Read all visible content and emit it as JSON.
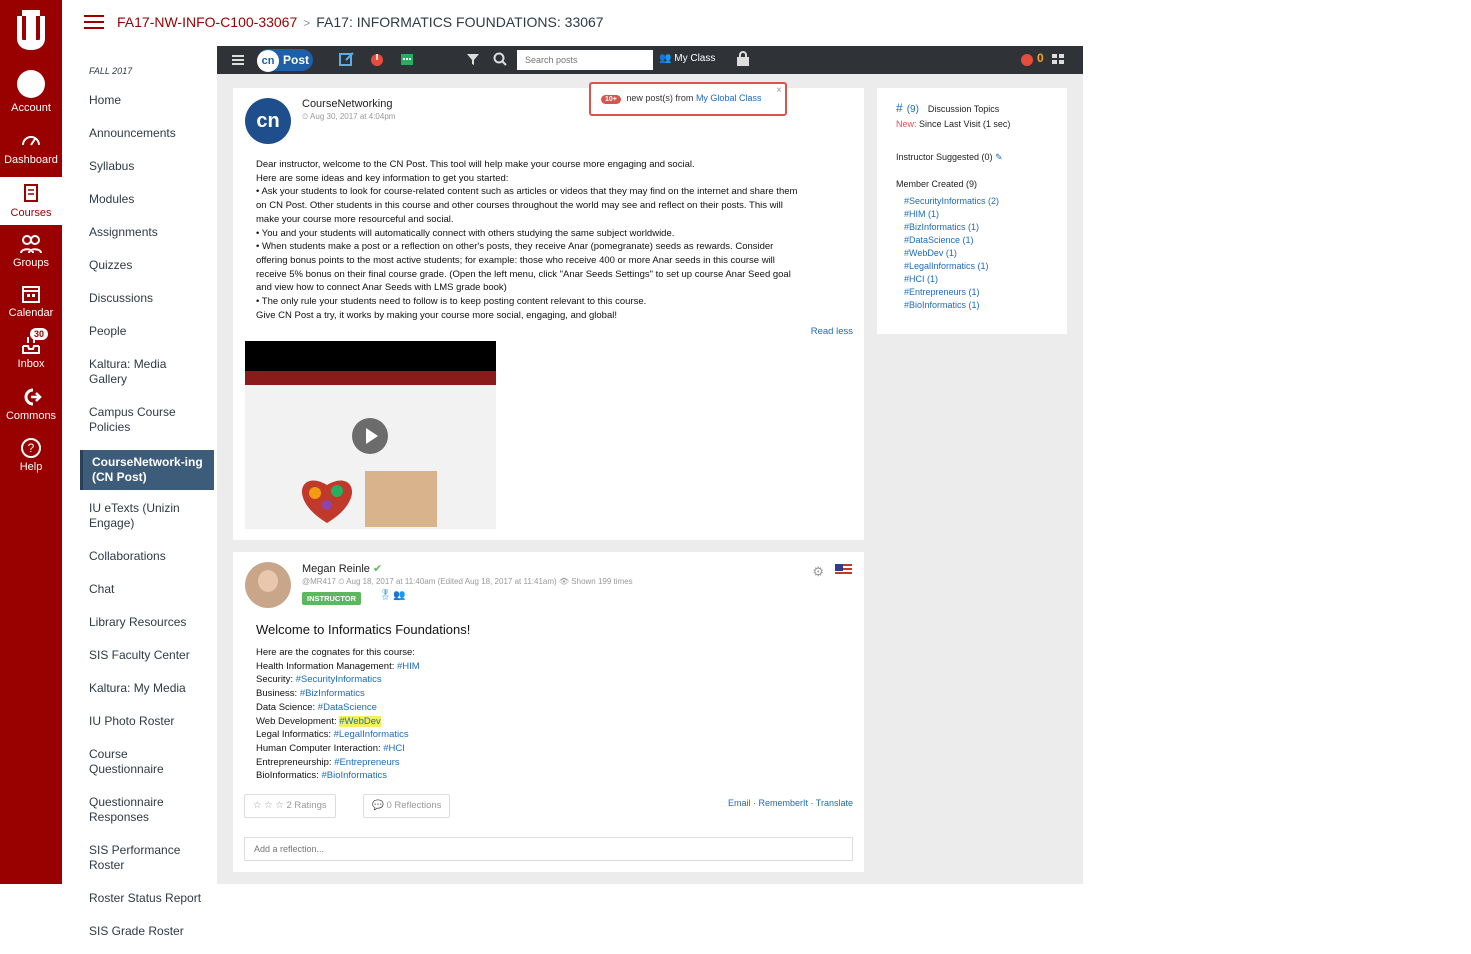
{
  "global_nav": {
    "account": "Account",
    "dashboard": "Dashboard",
    "courses": "Courses",
    "groups": "Groups",
    "calendar": "Calendar",
    "inbox": "Inbox",
    "inbox_badge": "30",
    "commons": "Commons",
    "help": "Help"
  },
  "breadcrumb": {
    "course_code": "FA17-NW-INFO-C100-33067",
    "current": "FA17: INFORMATICS FOUNDATIONS: 33067"
  },
  "course_nav": {
    "term": "FALL 2017",
    "items": [
      "Home",
      "Announcements",
      "Syllabus",
      "Modules",
      "Assignments",
      "Quizzes",
      "Discussions",
      "People",
      "Kaltura: Media Gallery",
      "Campus Course Policies",
      "CourseNetwork-ing (CN Post)",
      "IU eTexts (Unizin Engage)",
      "Collaborations",
      "Chat",
      "Library Resources",
      "SIS Faculty Center",
      "Kaltura: My Media",
      "IU Photo Roster",
      "Course Questionnaire",
      "Questionnaire Responses",
      "SIS Performance Roster",
      "Roster Status Report",
      "SIS Grade Roster"
    ],
    "active_index": 10
  },
  "toolbar": {
    "logo_mark": "cn",
    "logo_text": "Post",
    "search_placeholder": "Search posts",
    "my_class": "My Class",
    "anar_count": "0"
  },
  "notification": {
    "badge": "10+",
    "text": "new post(s) from",
    "link": "My Global Class",
    "close": "×"
  },
  "post1": {
    "avatar_text": "cn",
    "author": "CourseNetworking",
    "date": "Aug 30, 2017 at 4:04pm",
    "body_lines": [
      "Dear instructor, welcome to the CN Post. This tool will help make your course more engaging and social.",
      "Here are some ideas and key information to get you started:",
      "• Ask your students to look for course-related content such as articles or videos that they may find on the internet and share them",
      "on CN Post. Other students in this course and other courses throughout the world may see and reflect on their posts. This will",
      "make your course more resourceful and social.",
      "• You and your students will automatically connect with others studying the same subject worldwide.",
      "• When students make a post or a reflection on other's posts, they receive Anar (pomegranate) seeds as rewards. Consider",
      "offering bonus points to the most active students; for example: those who receive 400 or more Anar seeds in this course will",
      "receive 5% bonus on their final course grade. (Open the left menu, click \"Anar Seeds Settings\" to set up course Anar Seed goal",
      "and view how to connect Anar Seeds with LMS grade book)",
      "• The only rule your students need to follow is to keep posting content relevant to this course.",
      "Give CN Post a try, it works by making your course more social, engaging, and global!"
    ],
    "read_less": "Read less"
  },
  "post2": {
    "author": "Megan Reinle",
    "meta": "@MR417  ⏲ Aug 18, 2017 at 11:40am (Edited Aug 18, 2017 at 11:41am)  👁 Shown 199 times",
    "badge": "INSTRUCTOR",
    "title": "Welcome to Informatics Foundations!",
    "intro": "Here are the cognates for this course:",
    "cognates": [
      {
        "label": "Health Information Management:",
        "tag": "#HIM",
        "highlight": false
      },
      {
        "label": "Security:",
        "tag": "#SecurityInformatics",
        "highlight": false
      },
      {
        "label": "Business:",
        "tag": "#BizInformatics",
        "highlight": false
      },
      {
        "label": "Data Science:",
        "tag": "#DataScience",
        "highlight": false
      },
      {
        "label": "Web Development:",
        "tag": "#WebDev",
        "highlight": true
      },
      {
        "label": "Legal Informatics:",
        "tag": "#LegalInformatics",
        "highlight": false
      },
      {
        "label": "Human Computer Interaction:",
        "tag": "#HCI",
        "highlight": false
      },
      {
        "label": "Entrepreneurship:",
        "tag": "#Entrepreneurs",
        "highlight": false
      },
      {
        "label": "BioInformatics:",
        "tag": "#BioInformatics",
        "highlight": false
      }
    ],
    "ratings": "☆ ☆ ☆  2 Ratings",
    "reflections": "0 Reflections",
    "links": "Email · RememberIt · Translate",
    "add_reflection_placeholder": "Add a reflection..."
  },
  "topics": {
    "count": "(9)",
    "heading": "Discussion Topics",
    "new_label": "New:",
    "new_text": "Since Last Visit (1 sec)",
    "instructor_suggested": "Instructor Suggested (0)",
    "member_created": "Member Created (9)",
    "items": [
      "#SecurityInformatics (2)",
      "#HIM (1)",
      "#BizInformatics (1)",
      "#DataScience (1)",
      "#WebDev (1)",
      "#LegalInformatics (1)",
      "#HCI (1)",
      "#Entrepreneurs (1)",
      "#BioInformatics (1)"
    ]
  }
}
